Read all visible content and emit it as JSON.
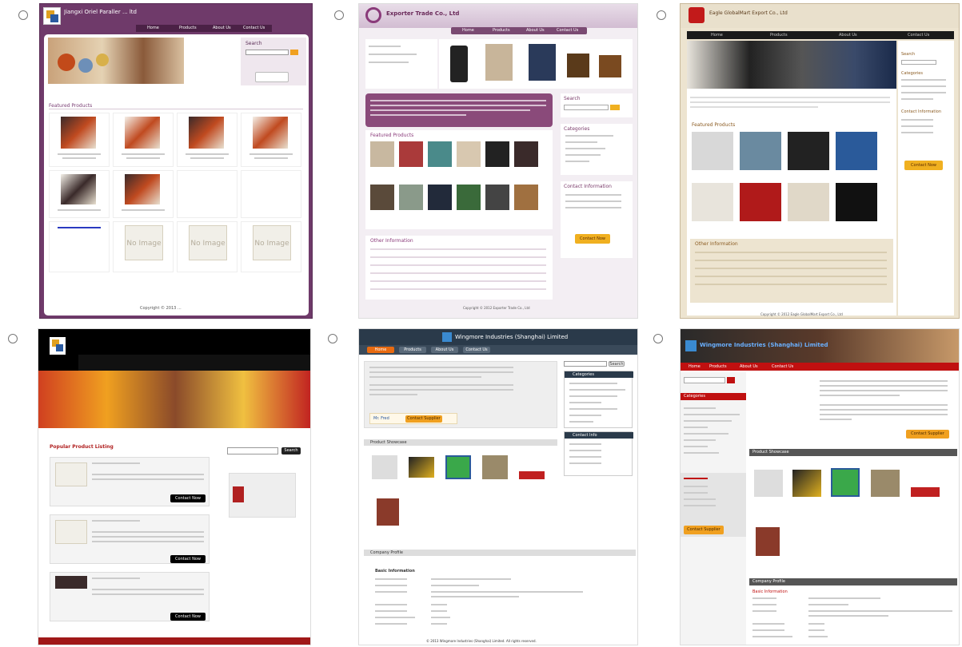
{
  "options": [
    {
      "id": "A",
      "company": "Jiangxi Oriel Paraller ... ltd",
      "nav": [
        "Home",
        "Products",
        "About Us",
        "Contact Us"
      ],
      "search_label": "Search",
      "section": "Featured Products",
      "no_image": "No Image",
      "footer": "Copyright © 2013 ..."
    },
    {
      "id": "B",
      "company": "Exporter Trade Co., Ltd",
      "nav": [
        "Home",
        "Products",
        "About Us",
        "Contact Us"
      ],
      "search_label": "Search",
      "section": "Featured Products",
      "categories": "Categories",
      "contact_info": "Contact Information",
      "other_info": "Other Information",
      "contact_now": "Contact Now",
      "footer": "Copyright © 2012 Exporter Trade Co., Ltd"
    },
    {
      "id": "C",
      "company": "Eagle GlobalMart Export Co., Ltd",
      "nav": [
        "Home",
        "Products",
        "About Us",
        "Contact Us"
      ],
      "search_label": "Search",
      "section": "Featured Products",
      "categories": "Categories",
      "contact_info": "Contact Information",
      "other_info": "Other Information",
      "contact_now": "Contact Now",
      "footer": "Copyright © 2012 Eagle GlobalMart Export Co., Ltd"
    },
    {
      "id": "D",
      "section": "Popular Product Listing",
      "contact_now": "Contact Now",
      "search_label": "Search"
    },
    {
      "id": "E",
      "company": "Wingmore Industries (Shanghai) Limited",
      "nav": [
        "Home",
        "Products",
        "About Us",
        "Contact Us"
      ],
      "search_btn": "Search",
      "categories": "Categories",
      "contact_info": "Contact Info",
      "product_showcase": "Product Showcase",
      "company_profile": "Company Profile",
      "basic_info": "Basic Information",
      "contact_supplier": "Contact Supplier",
      "mr_fred": "Mr. Fred",
      "footer": "© 2013 Wingmore Industries (Shanghai) Limited. All rights reserved."
    },
    {
      "id": "F",
      "company": "Wingmore Industries (Shanghai) Limited",
      "nav": [
        "Home",
        "Products",
        "About Us",
        "Contact Us"
      ],
      "categories": "Categories",
      "product_showcase": "Product Showcase",
      "company_profile": "Company Profile",
      "basic_info": "Basic Information",
      "contact_supplier": "Contact Supplier"
    }
  ]
}
